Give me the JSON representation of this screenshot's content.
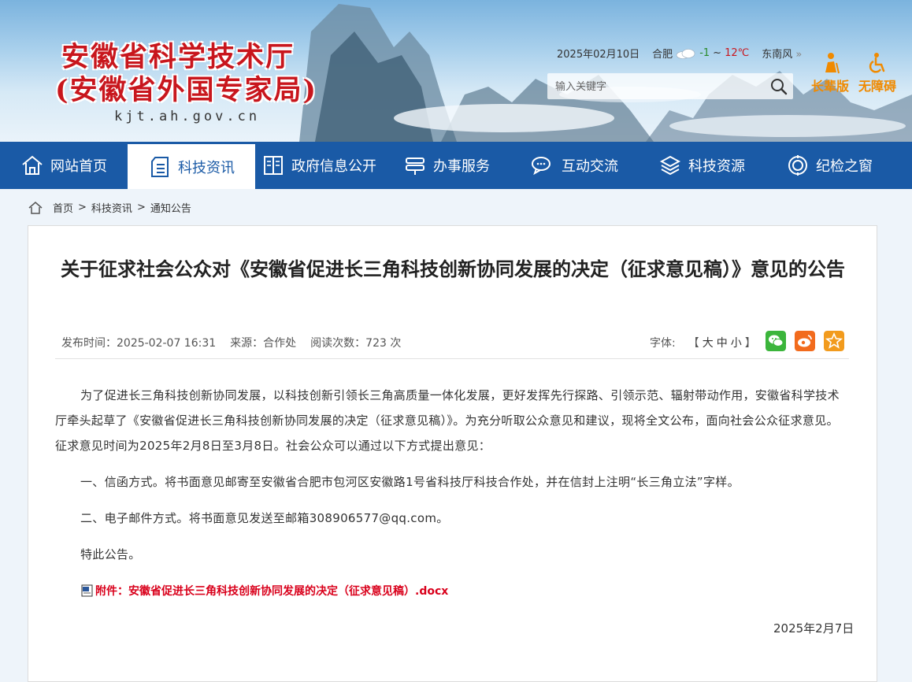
{
  "header": {
    "title_line1": "安徽省科学技术厅",
    "title_line2": "(安徽省外国专家局)",
    "domain": "kjt.ah.gov.cn",
    "date": "2025年02月10日",
    "city": "合肥",
    "temp_low": "-1",
    "temp_sep": "~",
    "temp_high": "12℃",
    "wind": "东南风",
    "wind_more": "»",
    "search_placeholder": "输入关键字",
    "elder_label": "长辈版",
    "accessible_label": "无障碍"
  },
  "nav": {
    "items": [
      {
        "label": "网站首页",
        "icon": "home-icon"
      },
      {
        "label": "科技资讯",
        "icon": "document-icon"
      },
      {
        "label": "政府信息公开",
        "icon": "book-icon"
      },
      {
        "label": "办事服务",
        "icon": "service-icon"
      },
      {
        "label": "互动交流",
        "icon": "chat-icon"
      },
      {
        "label": "科技资源",
        "icon": "cube-icon"
      },
      {
        "label": "纪检之窗",
        "icon": "badge-icon"
      }
    ],
    "active_index": 1
  },
  "breadcrumb": {
    "items": [
      "首页",
      "科技资讯",
      "通知公告"
    ],
    "separator": ">"
  },
  "article": {
    "title": "关于征求社会公众对《安徽省促进长三角科技创新协同发展的决定（征求意见稿）》意见的公告",
    "publish_time": "发布时间：2025-02-07 16:31",
    "source": "来源：合作处",
    "views": "阅读次数：723 次",
    "font_label": "字体:",
    "font_open": "【",
    "font_large": "大",
    "font_medium": "中",
    "font_small": "小",
    "font_close": "】",
    "paragraphs": [
      "为了促进长三角科技创新协同发展，以科技创新引领长三角高质量一体化发展，更好发挥先行探路、引领示范、辐射带动作用，安徽省科学技术厅牵头起草了《安徽省促进长三角科技创新协同发展的决定（征求意见稿）》。为充分听取公众意见和建议，现将全文公布，面向社会公众征求意见。征求意见时间为2025年2月8日至3月8日。社会公众可以通过以下方式提出意见：",
      "一、信函方式。将书面意见邮寄至安徽省合肥市包河区安徽路1号省科技厅科技合作处，并在信封上注明“长三角立法”字样。",
      "二、电子邮件方式。将书面意见发送至邮箱308906577@qq.com。",
      "特此公告。"
    ],
    "attachment": "附件：安徽省促进长三角科技创新协同发展的决定（征求意见稿）.docx",
    "sign_date": "2025年2月7日"
  },
  "share": [
    {
      "name": "wechat-share-button",
      "color": "#3bb53b"
    },
    {
      "name": "weibo-share-button",
      "color": "#f26b1d"
    },
    {
      "name": "favorite-button",
      "color": "#f29b1d"
    }
  ],
  "colors": {
    "nav_bg": "#1a5aa6",
    "title_red": "#c8161d",
    "accent_orange": "#f08a00",
    "attachment_red": "#d9001b"
  }
}
